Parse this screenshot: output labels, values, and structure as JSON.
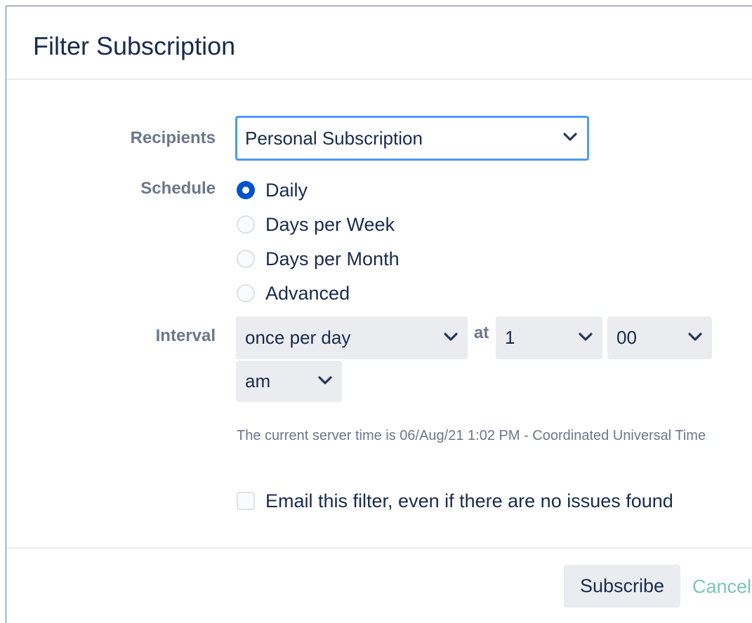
{
  "dialog": {
    "title": "Filter Subscription"
  },
  "form": {
    "recipients": {
      "label": "Recipients",
      "value": "Personal Subscription"
    },
    "schedule": {
      "label": "Schedule",
      "options": [
        "Daily",
        "Days per Week",
        "Days per Month",
        "Advanced"
      ],
      "selected": "Daily"
    },
    "interval": {
      "label": "Interval",
      "frequency": "once per day",
      "at_label": "at",
      "hour": "1",
      "minute": "00",
      "ampm": "am"
    },
    "server_time_note": "The current server time is 06/Aug/21 1:02 PM - Coordinated Universal Time",
    "email_empty": {
      "label": "Email this filter, even if there are no issues found",
      "checked": false
    }
  },
  "footer": {
    "subscribe_label": "Subscribe",
    "cancel_label": "Cancel"
  },
  "colors": {
    "primary": "#0052cc",
    "focus_ring": "#4c9aff",
    "label_gray": "#6b778c",
    "text": "#172b4d",
    "field_bg": "#ebecf0",
    "cancel_link": "#79c5b9"
  },
  "icons": [
    "chevron-down-icon"
  ]
}
